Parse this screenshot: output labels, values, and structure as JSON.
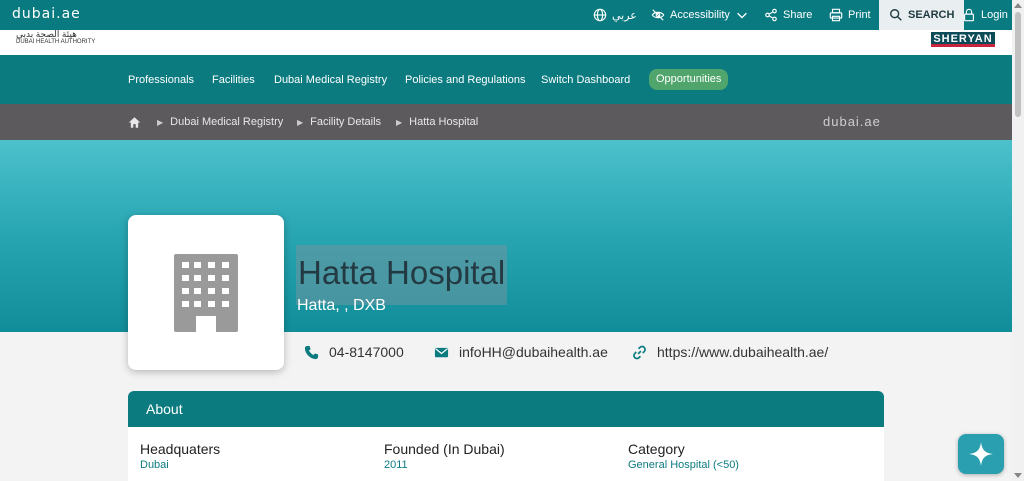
{
  "topbar": {
    "logo": "dubai.ae",
    "arabic": "عربي",
    "accessibility": "Accessibility",
    "share": "Share",
    "print": "Print",
    "search": "SEARCH",
    "login": "Login"
  },
  "header": {
    "dha_arabic": "هيئة الصحة بدبي",
    "dha_english": "DUBAI HEALTH AUTHORITY",
    "sheryan": "SHERYAN"
  },
  "nav": {
    "items": [
      "Professionals",
      "Facilities",
      "Dubai Medical Registry",
      "Policies and Regulations",
      "Switch Dashboard"
    ],
    "opportunities": "Opportunities"
  },
  "breadcrumb": {
    "items": [
      "Dubai Medical Registry",
      "Facility Details",
      "Hatta Hospital"
    ],
    "logo": "dubai.ae"
  },
  "facility": {
    "name": "Hatta Hospital",
    "location": "Hatta, , DXB",
    "phone": "04-8147000",
    "email": "infoHH@dubaihealth.ae",
    "website": "https://www.dubaihealth.ae/"
  },
  "about": {
    "title": "About",
    "headquarters_label": "Headquaters",
    "headquarters_value": "Dubai",
    "founded_label": "Founded (In Dubai)",
    "founded_value": "2011",
    "category_label": "Category",
    "category_value": "General Hospital (<50)"
  },
  "colors": {
    "primary": "#0b7b80",
    "breadcrumb_bg": "#5c5a5d",
    "accent_green": "#4fa56b"
  }
}
